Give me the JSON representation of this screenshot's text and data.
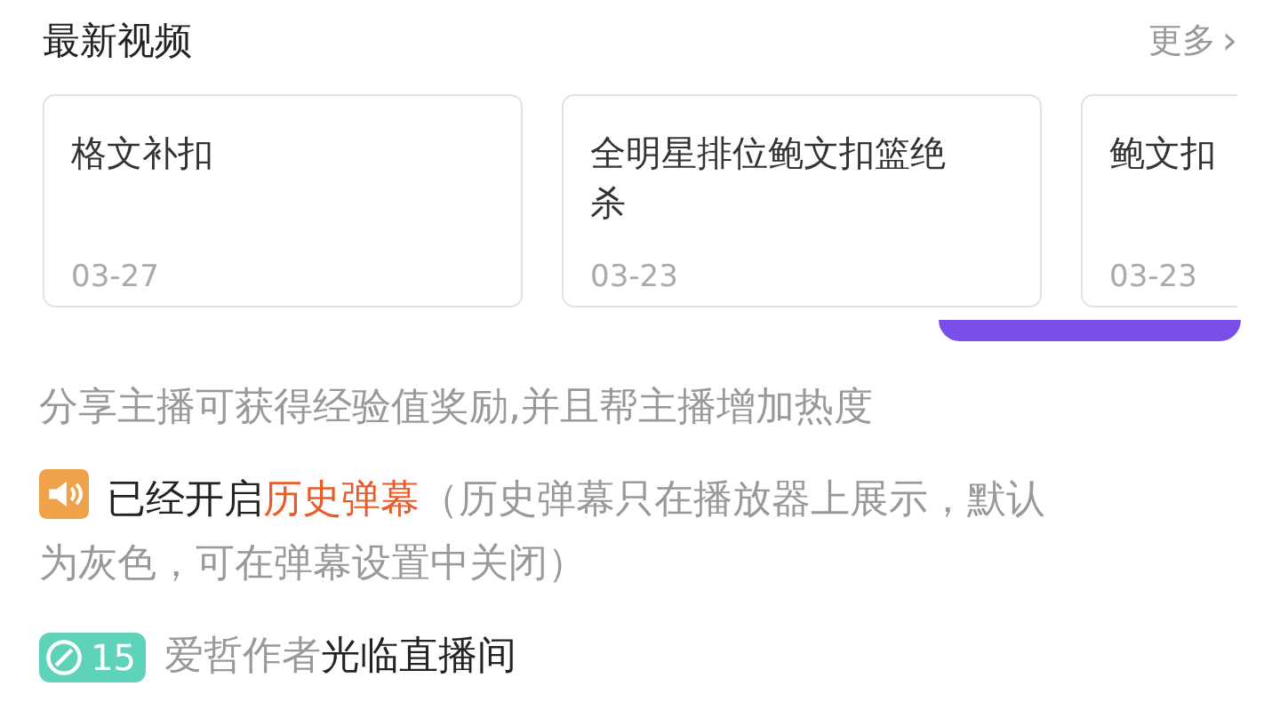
{
  "section": {
    "title": "最新视频",
    "more": "更多",
    "more_arrow": "›"
  },
  "videos": [
    {
      "title": "格文补扣",
      "date": "03-27"
    },
    {
      "title": "全明星排位鲍文扣篮绝杀",
      "date": "03-23"
    },
    {
      "title": "鲍文扣",
      "date": "03-23"
    }
  ],
  "messages": [
    {
      "kind": "notice",
      "parts": [
        {
          "text": "分享主播可获得经验值奖励,并且帮主播增加热度",
          "color": "#999999"
        }
      ]
    },
    {
      "kind": "system",
      "parts": [
        {
          "text": "已经开启",
          "color": "#222222"
        },
        {
          "text": "历史弹幕",
          "color": "#ea5b2a"
        },
        {
          "text": "（历史弹幕只在播放器上展示，默认为灰色，可在弹幕设置中关闭）",
          "color": "#999999"
        }
      ]
    },
    {
      "kind": "enter",
      "level": "15",
      "parts": [
        {
          "text": "爱哲作者",
          "color": "#999999"
        },
        {
          "text": "光临直播间",
          "color": "#222222"
        }
      ]
    }
  ]
}
